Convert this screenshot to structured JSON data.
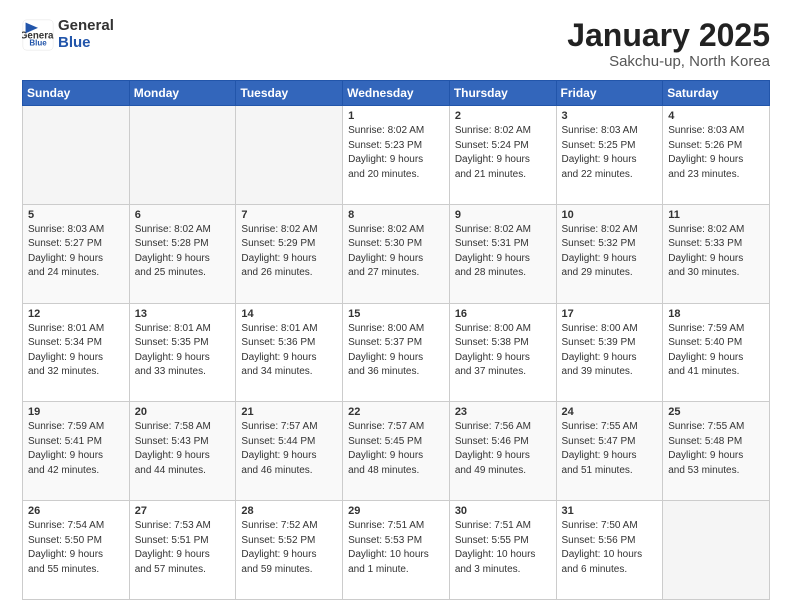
{
  "logo": {
    "general": "General",
    "blue": "Blue"
  },
  "title": "January 2025",
  "subtitle": "Sakchu-up, North Korea",
  "days_header": [
    "Sunday",
    "Monday",
    "Tuesday",
    "Wednesday",
    "Thursday",
    "Friday",
    "Saturday"
  ],
  "weeks": [
    [
      {
        "num": "",
        "info": ""
      },
      {
        "num": "",
        "info": ""
      },
      {
        "num": "",
        "info": ""
      },
      {
        "num": "1",
        "info": "Sunrise: 8:02 AM\nSunset: 5:23 PM\nDaylight: 9 hours\nand 20 minutes."
      },
      {
        "num": "2",
        "info": "Sunrise: 8:02 AM\nSunset: 5:24 PM\nDaylight: 9 hours\nand 21 minutes."
      },
      {
        "num": "3",
        "info": "Sunrise: 8:03 AM\nSunset: 5:25 PM\nDaylight: 9 hours\nand 22 minutes."
      },
      {
        "num": "4",
        "info": "Sunrise: 8:03 AM\nSunset: 5:26 PM\nDaylight: 9 hours\nand 23 minutes."
      }
    ],
    [
      {
        "num": "5",
        "info": "Sunrise: 8:03 AM\nSunset: 5:27 PM\nDaylight: 9 hours\nand 24 minutes."
      },
      {
        "num": "6",
        "info": "Sunrise: 8:02 AM\nSunset: 5:28 PM\nDaylight: 9 hours\nand 25 minutes."
      },
      {
        "num": "7",
        "info": "Sunrise: 8:02 AM\nSunset: 5:29 PM\nDaylight: 9 hours\nand 26 minutes."
      },
      {
        "num": "8",
        "info": "Sunrise: 8:02 AM\nSunset: 5:30 PM\nDaylight: 9 hours\nand 27 minutes."
      },
      {
        "num": "9",
        "info": "Sunrise: 8:02 AM\nSunset: 5:31 PM\nDaylight: 9 hours\nand 28 minutes."
      },
      {
        "num": "10",
        "info": "Sunrise: 8:02 AM\nSunset: 5:32 PM\nDaylight: 9 hours\nand 29 minutes."
      },
      {
        "num": "11",
        "info": "Sunrise: 8:02 AM\nSunset: 5:33 PM\nDaylight: 9 hours\nand 30 minutes."
      }
    ],
    [
      {
        "num": "12",
        "info": "Sunrise: 8:01 AM\nSunset: 5:34 PM\nDaylight: 9 hours\nand 32 minutes."
      },
      {
        "num": "13",
        "info": "Sunrise: 8:01 AM\nSunset: 5:35 PM\nDaylight: 9 hours\nand 33 minutes."
      },
      {
        "num": "14",
        "info": "Sunrise: 8:01 AM\nSunset: 5:36 PM\nDaylight: 9 hours\nand 34 minutes."
      },
      {
        "num": "15",
        "info": "Sunrise: 8:00 AM\nSunset: 5:37 PM\nDaylight: 9 hours\nand 36 minutes."
      },
      {
        "num": "16",
        "info": "Sunrise: 8:00 AM\nSunset: 5:38 PM\nDaylight: 9 hours\nand 37 minutes."
      },
      {
        "num": "17",
        "info": "Sunrise: 8:00 AM\nSunset: 5:39 PM\nDaylight: 9 hours\nand 39 minutes."
      },
      {
        "num": "18",
        "info": "Sunrise: 7:59 AM\nSunset: 5:40 PM\nDaylight: 9 hours\nand 41 minutes."
      }
    ],
    [
      {
        "num": "19",
        "info": "Sunrise: 7:59 AM\nSunset: 5:41 PM\nDaylight: 9 hours\nand 42 minutes."
      },
      {
        "num": "20",
        "info": "Sunrise: 7:58 AM\nSunset: 5:43 PM\nDaylight: 9 hours\nand 44 minutes."
      },
      {
        "num": "21",
        "info": "Sunrise: 7:57 AM\nSunset: 5:44 PM\nDaylight: 9 hours\nand 46 minutes."
      },
      {
        "num": "22",
        "info": "Sunrise: 7:57 AM\nSunset: 5:45 PM\nDaylight: 9 hours\nand 48 minutes."
      },
      {
        "num": "23",
        "info": "Sunrise: 7:56 AM\nSunset: 5:46 PM\nDaylight: 9 hours\nand 49 minutes."
      },
      {
        "num": "24",
        "info": "Sunrise: 7:55 AM\nSunset: 5:47 PM\nDaylight: 9 hours\nand 51 minutes."
      },
      {
        "num": "25",
        "info": "Sunrise: 7:55 AM\nSunset: 5:48 PM\nDaylight: 9 hours\nand 53 minutes."
      }
    ],
    [
      {
        "num": "26",
        "info": "Sunrise: 7:54 AM\nSunset: 5:50 PM\nDaylight: 9 hours\nand 55 minutes."
      },
      {
        "num": "27",
        "info": "Sunrise: 7:53 AM\nSunset: 5:51 PM\nDaylight: 9 hours\nand 57 minutes."
      },
      {
        "num": "28",
        "info": "Sunrise: 7:52 AM\nSunset: 5:52 PM\nDaylight: 9 hours\nand 59 minutes."
      },
      {
        "num": "29",
        "info": "Sunrise: 7:51 AM\nSunset: 5:53 PM\nDaylight: 10 hours\nand 1 minute."
      },
      {
        "num": "30",
        "info": "Sunrise: 7:51 AM\nSunset: 5:55 PM\nDaylight: 10 hours\nand 3 minutes."
      },
      {
        "num": "31",
        "info": "Sunrise: 7:50 AM\nSunset: 5:56 PM\nDaylight: 10 hours\nand 6 minutes."
      },
      {
        "num": "",
        "info": ""
      }
    ]
  ]
}
